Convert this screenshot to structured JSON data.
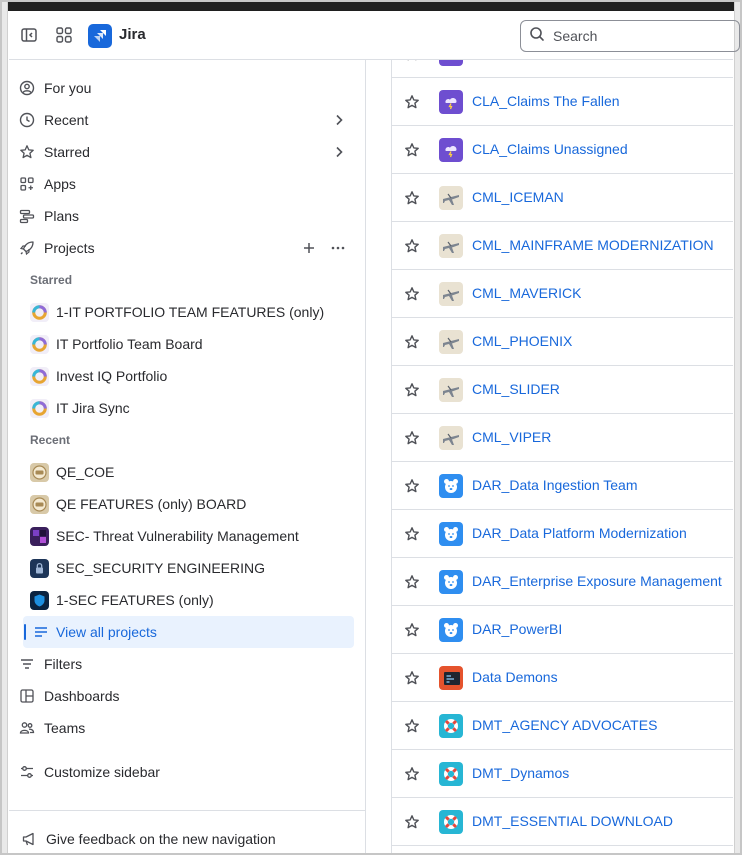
{
  "app": {
    "name": "Jira"
  },
  "search": {
    "placeholder": "Search"
  },
  "sidebar": {
    "nav": [
      {
        "label": "For you",
        "icon": "person-circle-icon"
      },
      {
        "label": "Recent",
        "icon": "clock-icon"
      },
      {
        "label": "Starred",
        "icon": "star-icon"
      },
      {
        "label": "Apps",
        "icon": "apps-icon"
      },
      {
        "label": "Plans",
        "icon": "plans-icon"
      },
      {
        "label": "Projects",
        "icon": "rocket-icon"
      }
    ],
    "starred_heading": "Starred",
    "starred": [
      {
        "label": "1-IT PORTFOLIO TEAM FEATURES (only)",
        "avatar": "ring"
      },
      {
        "label": "IT Portfolio Team Board",
        "avatar": "ring"
      },
      {
        "label": "Invest IQ Portfolio",
        "avatar": "ring"
      },
      {
        "label": "IT Jira Sync",
        "avatar": "ring"
      }
    ],
    "recent_heading": "Recent",
    "recent": [
      {
        "label": "QE_COE",
        "avatar": "badge"
      },
      {
        "label": "QE FEATURES (only) BOARD",
        "avatar": "badge"
      },
      {
        "label": "SEC- Threat Vulnerability Management",
        "avatar": "purple"
      },
      {
        "label": "SEC_SECURITY ENGINEERING",
        "avatar": "lock"
      },
      {
        "label": "1-SEC FEATURES (only)",
        "avatar": "shield"
      }
    ],
    "view_all": "View all projects",
    "bottom_nav": [
      {
        "label": "Filters",
        "icon": "filter-icon"
      },
      {
        "label": "Dashboards",
        "icon": "dashboard-icon"
      },
      {
        "label": "Teams",
        "icon": "people-icon"
      }
    ],
    "customize": "Customize sidebar",
    "feedback": "Give feedback on the new navigation"
  },
  "projects": [
    {
      "name": "CLA_Claims The Fallen",
      "avatar": "storm"
    },
    {
      "name": "CLA_Claims Unassigned",
      "avatar": "storm"
    },
    {
      "name": "CML_ICEMAN",
      "avatar": "jet"
    },
    {
      "name": "CML_MAINFRAME MODERNIZATION",
      "avatar": "jet"
    },
    {
      "name": "CML_MAVERICK",
      "avatar": "jet"
    },
    {
      "name": "CML_PHOENIX",
      "avatar": "jet"
    },
    {
      "name": "CML_SLIDER",
      "avatar": "jet"
    },
    {
      "name": "CML_VIPER",
      "avatar": "jet"
    },
    {
      "name": "DAR_Data Ingestion Team",
      "avatar": "bear"
    },
    {
      "name": "DAR_Data Platform Modernization",
      "avatar": "bear"
    },
    {
      "name": "DAR_Enterprise Exposure Management",
      "avatar": "bear"
    },
    {
      "name": "DAR_PowerBI",
      "avatar": "bear"
    },
    {
      "name": "Data Demons",
      "avatar": "code"
    },
    {
      "name": "DMT_AGENCY ADVOCATES",
      "avatar": "lifebuoy"
    },
    {
      "name": "DMT_Dynamos",
      "avatar": "lifebuoy"
    },
    {
      "name": "DMT_ESSENTIAL DOWNLOAD",
      "avatar": "lifebuoy"
    }
  ],
  "colors": {
    "accent": "#1868db",
    "active_bg": "#e9f2fe",
    "text": "#292a2e",
    "muted": "#6b6e76",
    "border": "#dcdfe4"
  }
}
